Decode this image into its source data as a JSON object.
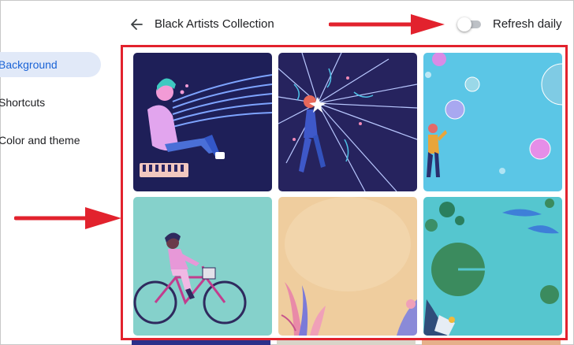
{
  "sidebar": {
    "items": [
      {
        "label": "Background",
        "active": true
      },
      {
        "label": "Shortcuts",
        "active": false
      },
      {
        "label": "Color and theme",
        "active": false
      }
    ]
  },
  "header": {
    "back_icon": "arrow-back-icon",
    "title": "Black Artists Collection",
    "refresh_label": "Refresh daily",
    "refresh_enabled": false
  },
  "wallpapers": [
    {
      "name": "keyboard-musician",
      "bg": "#1e1f58"
    },
    {
      "name": "starburst-figure",
      "bg": "#26235e"
    },
    {
      "name": "bubbles",
      "bg": "#5bc6e6"
    },
    {
      "name": "cyclist",
      "bg": "#85d1cb"
    },
    {
      "name": "peach-plants",
      "bg": "#efcd9e"
    },
    {
      "name": "lily-pads",
      "bg": "#55c6cf"
    }
  ],
  "annotation_color": "#e2222d"
}
